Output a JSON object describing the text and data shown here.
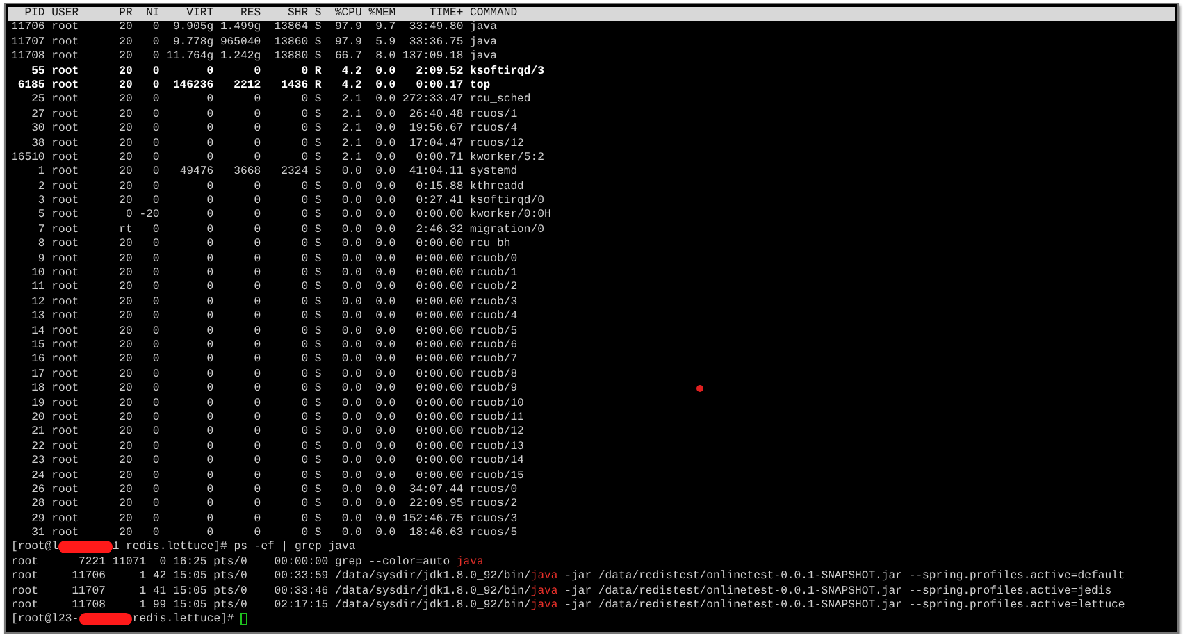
{
  "top": {
    "columns": [
      "PID",
      "USER",
      "PR",
      "NI",
      "VIRT",
      "RES",
      "SHR",
      "S",
      "%CPU",
      "%MEM",
      "TIME+",
      "COMMAND"
    ],
    "rows": [
      {
        "cells": [
          "11706",
          "root",
          "20",
          "0",
          "9.905g",
          "1.499g",
          "13864",
          "S",
          "97.9",
          "9.7",
          "33:49.80",
          "java"
        ],
        "bold": false
      },
      {
        "cells": [
          "11707",
          "root",
          "20",
          "0",
          "9.778g",
          "965040",
          "13860",
          "S",
          "97.9",
          "5.9",
          "33:36.75",
          "java"
        ],
        "bold": false
      },
      {
        "cells": [
          "11708",
          "root",
          "20",
          "0",
          "11.764g",
          "1.242g",
          "13880",
          "S",
          "66.7",
          "8.0",
          "137:09.18",
          "java"
        ],
        "bold": false
      },
      {
        "cells": [
          "55",
          "root",
          "20",
          "0",
          "0",
          "0",
          "0",
          "R",
          "4.2",
          "0.0",
          "2:09.52",
          "ksoftirqd/3"
        ],
        "bold": true
      },
      {
        "cells": [
          "6185",
          "root",
          "20",
          "0",
          "146236",
          "2212",
          "1436",
          "R",
          "4.2",
          "0.0",
          "0:00.17",
          "top"
        ],
        "bold": true
      },
      {
        "cells": [
          "25",
          "root",
          "20",
          "0",
          "0",
          "0",
          "0",
          "S",
          "2.1",
          "0.0",
          "272:33.47",
          "rcu_sched"
        ],
        "bold": false
      },
      {
        "cells": [
          "27",
          "root",
          "20",
          "0",
          "0",
          "0",
          "0",
          "S",
          "2.1",
          "0.0",
          "26:40.48",
          "rcuos/1"
        ],
        "bold": false
      },
      {
        "cells": [
          "30",
          "root",
          "20",
          "0",
          "0",
          "0",
          "0",
          "S",
          "2.1",
          "0.0",
          "19:56.67",
          "rcuos/4"
        ],
        "bold": false
      },
      {
        "cells": [
          "38",
          "root",
          "20",
          "0",
          "0",
          "0",
          "0",
          "S",
          "2.1",
          "0.0",
          "17:04.47",
          "rcuos/12"
        ],
        "bold": false
      },
      {
        "cells": [
          "16510",
          "root",
          "20",
          "0",
          "0",
          "0",
          "0",
          "S",
          "2.1",
          "0.0",
          "0:00.71",
          "kworker/5:2"
        ],
        "bold": false
      },
      {
        "cells": [
          "1",
          "root",
          "20",
          "0",
          "49476",
          "3668",
          "2324",
          "S",
          "0.0",
          "0.0",
          "41:04.11",
          "systemd"
        ],
        "bold": false
      },
      {
        "cells": [
          "2",
          "root",
          "20",
          "0",
          "0",
          "0",
          "0",
          "S",
          "0.0",
          "0.0",
          "0:15.88",
          "kthreadd"
        ],
        "bold": false
      },
      {
        "cells": [
          "3",
          "root",
          "20",
          "0",
          "0",
          "0",
          "0",
          "S",
          "0.0",
          "0.0",
          "0:27.41",
          "ksoftirqd/0"
        ],
        "bold": false
      },
      {
        "cells": [
          "5",
          "root",
          "0",
          "-20",
          "0",
          "0",
          "0",
          "S",
          "0.0",
          "0.0",
          "0:00.00",
          "kworker/0:0H"
        ],
        "bold": false
      },
      {
        "cells": [
          "7",
          "root",
          "rt",
          "0",
          "0",
          "0",
          "0",
          "S",
          "0.0",
          "0.0",
          "2:46.32",
          "migration/0"
        ],
        "bold": false
      },
      {
        "cells": [
          "8",
          "root",
          "20",
          "0",
          "0",
          "0",
          "0",
          "S",
          "0.0",
          "0.0",
          "0:00.00",
          "rcu_bh"
        ],
        "bold": false
      },
      {
        "cells": [
          "9",
          "root",
          "20",
          "0",
          "0",
          "0",
          "0",
          "S",
          "0.0",
          "0.0",
          "0:00.00",
          "rcuob/0"
        ],
        "bold": false
      },
      {
        "cells": [
          "10",
          "root",
          "20",
          "0",
          "0",
          "0",
          "0",
          "S",
          "0.0",
          "0.0",
          "0:00.00",
          "rcuob/1"
        ],
        "bold": false
      },
      {
        "cells": [
          "11",
          "root",
          "20",
          "0",
          "0",
          "0",
          "0",
          "S",
          "0.0",
          "0.0",
          "0:00.00",
          "rcuob/2"
        ],
        "bold": false
      },
      {
        "cells": [
          "12",
          "root",
          "20",
          "0",
          "0",
          "0",
          "0",
          "S",
          "0.0",
          "0.0",
          "0:00.00",
          "rcuob/3"
        ],
        "bold": false
      },
      {
        "cells": [
          "13",
          "root",
          "20",
          "0",
          "0",
          "0",
          "0",
          "S",
          "0.0",
          "0.0",
          "0:00.00",
          "rcuob/4"
        ],
        "bold": false
      },
      {
        "cells": [
          "14",
          "root",
          "20",
          "0",
          "0",
          "0",
          "0",
          "S",
          "0.0",
          "0.0",
          "0:00.00",
          "rcuob/5"
        ],
        "bold": false
      },
      {
        "cells": [
          "15",
          "root",
          "20",
          "0",
          "0",
          "0",
          "0",
          "S",
          "0.0",
          "0.0",
          "0:00.00",
          "rcuob/6"
        ],
        "bold": false
      },
      {
        "cells": [
          "16",
          "root",
          "20",
          "0",
          "0",
          "0",
          "0",
          "S",
          "0.0",
          "0.0",
          "0:00.00",
          "rcuob/7"
        ],
        "bold": false
      },
      {
        "cells": [
          "17",
          "root",
          "20",
          "0",
          "0",
          "0",
          "0",
          "S",
          "0.0",
          "0.0",
          "0:00.00",
          "rcuob/8"
        ],
        "bold": false
      },
      {
        "cells": [
          "18",
          "root",
          "20",
          "0",
          "0",
          "0",
          "0",
          "S",
          "0.0",
          "0.0",
          "0:00.00",
          "rcuob/9"
        ],
        "bold": false
      },
      {
        "cells": [
          "19",
          "root",
          "20",
          "0",
          "0",
          "0",
          "0",
          "S",
          "0.0",
          "0.0",
          "0:00.00",
          "rcuob/10"
        ],
        "bold": false
      },
      {
        "cells": [
          "20",
          "root",
          "20",
          "0",
          "0",
          "0",
          "0",
          "S",
          "0.0",
          "0.0",
          "0:00.00",
          "rcuob/11"
        ],
        "bold": false
      },
      {
        "cells": [
          "21",
          "root",
          "20",
          "0",
          "0",
          "0",
          "0",
          "S",
          "0.0",
          "0.0",
          "0:00.00",
          "rcuob/12"
        ],
        "bold": false
      },
      {
        "cells": [
          "22",
          "root",
          "20",
          "0",
          "0",
          "0",
          "0",
          "S",
          "0.0",
          "0.0",
          "0:00.00",
          "rcuob/13"
        ],
        "bold": false
      },
      {
        "cells": [
          "23",
          "root",
          "20",
          "0",
          "0",
          "0",
          "0",
          "S",
          "0.0",
          "0.0",
          "0:00.00",
          "rcuob/14"
        ],
        "bold": false
      },
      {
        "cells": [
          "24",
          "root",
          "20",
          "0",
          "0",
          "0",
          "0",
          "S",
          "0.0",
          "0.0",
          "0:00.00",
          "rcuob/15"
        ],
        "bold": false
      },
      {
        "cells": [
          "26",
          "root",
          "20",
          "0",
          "0",
          "0",
          "0",
          "S",
          "0.0",
          "0.0",
          "34:07.44",
          "rcuos/0"
        ],
        "bold": false
      },
      {
        "cells": [
          "28",
          "root",
          "20",
          "0",
          "0",
          "0",
          "0",
          "S",
          "0.0",
          "0.0",
          "22:09.95",
          "rcuos/2"
        ],
        "bold": false
      },
      {
        "cells": [
          "29",
          "root",
          "20",
          "0",
          "0",
          "0",
          "0",
          "S",
          "0.0",
          "0.0",
          "152:46.75",
          "rcuos/3"
        ],
        "bold": false
      },
      {
        "cells": [
          "31",
          "root",
          "20",
          "0",
          "0",
          "0",
          "0",
          "S",
          "0.0",
          "0.0",
          "18:46.63",
          "rcuos/5"
        ],
        "bold": false
      }
    ]
  },
  "shell": [
    {
      "kind": "prompt",
      "before": "[root@l",
      "after": "1 redis.lettuce]#",
      "command": "ps -ef | grep java",
      "cursor": false
    },
    {
      "kind": "process",
      "cells": [
        "root",
        "7221",
        "11071",
        "0",
        "16:25",
        "pts/0",
        "00:00:00"
      ],
      "cmd": [
        {
          "text": "grep --color=auto ",
          "highlight": false
        },
        {
          "text": "java",
          "highlight": true
        }
      ]
    },
    {
      "kind": "process",
      "cells": [
        "root",
        "11706",
        "1",
        "42",
        "15:05",
        "pts/0",
        "00:33:59"
      ],
      "cmd": [
        {
          "text": "/data/sysdir/jdk1.8.0_92/bin/",
          "highlight": false
        },
        {
          "text": "java",
          "highlight": true
        },
        {
          "text": " -jar /data/redistest/onlinetest-0.0.1-SNAPSHOT.jar --spring.profiles.active=default",
          "highlight": false
        }
      ]
    },
    {
      "kind": "process",
      "cells": [
        "root",
        "11707",
        "1",
        "41",
        "15:05",
        "pts/0",
        "00:33:46"
      ],
      "cmd": [
        {
          "text": "/data/sysdir/jdk1.8.0_92/bin/",
          "highlight": false
        },
        {
          "text": "java",
          "highlight": true
        },
        {
          "text": " -jar /data/redistest/onlinetest-0.0.1-SNAPSHOT.jar --spring.profiles.active=jedis",
          "highlight": false
        }
      ]
    },
    {
      "kind": "process",
      "cells": [
        "root",
        "11708",
        "1",
        "99",
        "15:05",
        "pts/0",
        "02:17:15"
      ],
      "cmd": [
        {
          "text": "/data/sysdir/jdk1.8.0_92/bin/",
          "highlight": false
        },
        {
          "text": "java",
          "highlight": true
        },
        {
          "text": " -jar /data/redistest/onlinetest-0.0.1-SNAPSHOT.jar --spring.profiles.active=lettuce",
          "highlight": false
        }
      ]
    },
    {
      "kind": "prompt",
      "before": "[root@l23-",
      "after": "redis.lettuce]#",
      "cursor": true
    }
  ]
}
